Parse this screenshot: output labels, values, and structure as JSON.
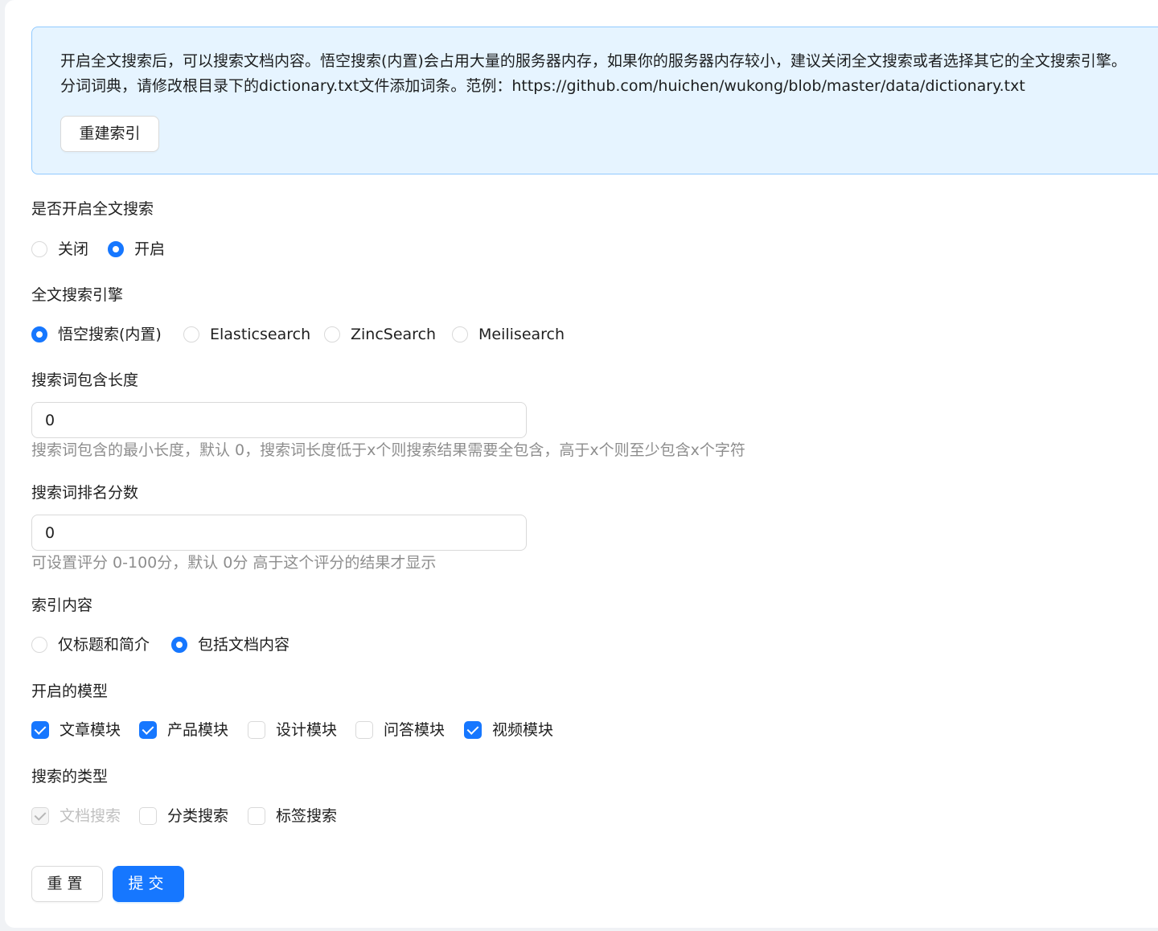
{
  "alert": {
    "line1": "开启全文搜索后，可以搜索文档内容。悟空搜索(内置)会占用大量的服务器内存，如果你的服务器内存较小，建议关闭全文搜索或者选择其它的全文搜索引擎。",
    "line2": "分词词典，请修改根目录下的dictionary.txt文件添加词条。范例：https://github.com/huichen/wukong/blob/master/data/dictionary.txt",
    "rebuild_label": "重建索引"
  },
  "enable_search": {
    "label": "是否开启全文搜索",
    "options": [
      {
        "label": "关闭",
        "checked": false
      },
      {
        "label": "开启",
        "checked": true
      }
    ]
  },
  "engine": {
    "label": "全文搜索引擎",
    "options": [
      {
        "label": "悟空搜索(内置)",
        "checked": true
      },
      {
        "label": "Elasticsearch",
        "checked": false
      },
      {
        "label": "ZincSearch",
        "checked": false
      },
      {
        "label": "Meilisearch",
        "checked": false
      }
    ]
  },
  "min_length": {
    "label": "搜索词包含长度",
    "value": "0",
    "help": "搜索词包含的最小长度，默认 0，搜索词长度低于x个则搜索结果需要全包含，高于x个则至少包含x个字符"
  },
  "min_score": {
    "label": "搜索词排名分数",
    "value": "0",
    "help": "可设置评分 0-100分，默认 0分 高于这个评分的结果才显示"
  },
  "index_content": {
    "label": "索引内容",
    "options": [
      {
        "label": "仅标题和简介",
        "checked": false
      },
      {
        "label": "包括文档内容",
        "checked": true
      }
    ]
  },
  "models": {
    "label": "开启的模型",
    "options": [
      {
        "label": "文章模块",
        "checked": true
      },
      {
        "label": "产品模块",
        "checked": true
      },
      {
        "label": "设计模块",
        "checked": false
      },
      {
        "label": "问答模块",
        "checked": false
      },
      {
        "label": "视频模块",
        "checked": true
      }
    ]
  },
  "search_types": {
    "label": "搜索的类型",
    "options": [
      {
        "label": "文档搜索",
        "checked": true,
        "disabled": true
      },
      {
        "label": "分类搜索",
        "checked": false
      },
      {
        "label": "标签搜索",
        "checked": false
      }
    ]
  },
  "actions": {
    "reset_label": "重置",
    "submit_label": "提交"
  },
  "colors": {
    "primary": "#1677ff",
    "alert_bg": "#e6f4ff",
    "alert_border": "#91caff"
  }
}
